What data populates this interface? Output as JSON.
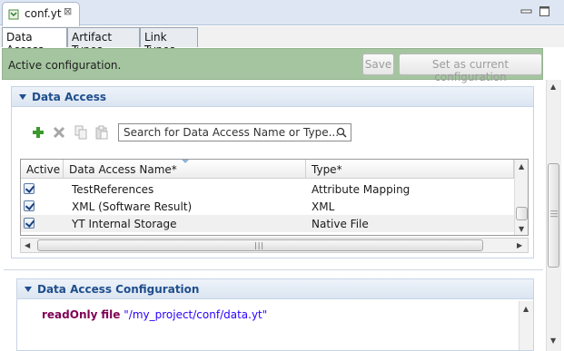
{
  "editor": {
    "tab_title": "conf.yt",
    "icons": {
      "file": "file-icon",
      "close": "close-icon",
      "minimize": "minimize-icon",
      "maximize": "maximize-icon"
    }
  },
  "page_tabs": [
    {
      "label": "Data Access",
      "active": true
    },
    {
      "label": "Artifact Types",
      "active": false
    },
    {
      "label": "Link Types",
      "active": false
    }
  ],
  "header": {
    "message": "Active configuration.",
    "save_label": "Save",
    "set_current_label": "Set as current configuration",
    "background": "#a5c5a0"
  },
  "data_access_section": {
    "title": "Data Access",
    "toolbar_icons": [
      "add-icon",
      "delete-icon",
      "copy-icon",
      "paste-icon"
    ],
    "search": {
      "placeholder": "Search for Data Access Name or Type...",
      "value": ""
    },
    "table": {
      "columns": [
        "Active",
        "Data Access Name*",
        "Type*"
      ],
      "rows": [
        {
          "active": true,
          "name": "TestReferences",
          "type": "Attribute Mapping"
        },
        {
          "active": true,
          "name": "XML (Software Result)",
          "type": "XML"
        },
        {
          "active": true,
          "name": "YT Internal Storage",
          "type": "Native File"
        }
      ]
    }
  },
  "config_section": {
    "title": "Data Access Configuration",
    "code": {
      "kw1": "readOnly",
      "kw2": "file",
      "path": "\"/my_project/conf/data.yt\""
    }
  },
  "colors": {
    "section_title": "#1f4e8c",
    "keyword": "#7f0055",
    "string": "#2a00ff"
  }
}
